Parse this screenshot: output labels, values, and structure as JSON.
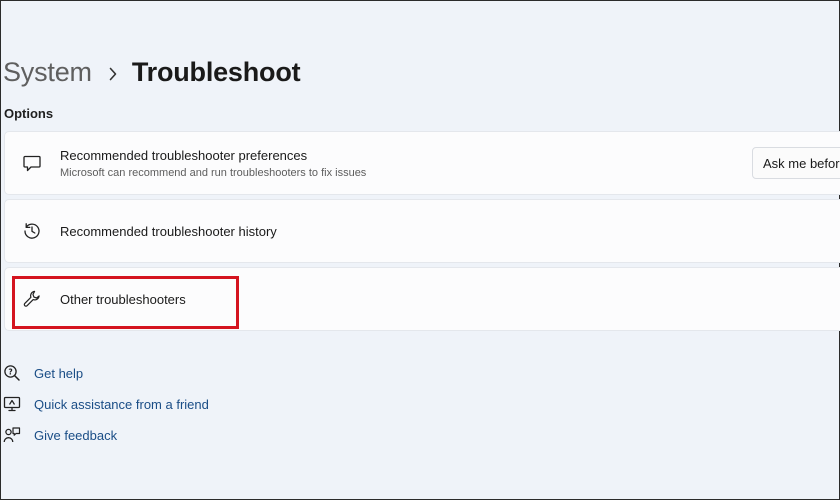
{
  "breadcrumb": {
    "parent": "System",
    "separator": "›",
    "current": "Troubleshoot"
  },
  "options_label": "Options",
  "cards": [
    {
      "title": "Recommended troubleshooter preferences",
      "subtitle": "Microsoft can recommend and run troubleshooters to fix issues",
      "icon": "chat-bubble-icon",
      "dropdown_value": "Ask me before"
    },
    {
      "title": "Recommended troubleshooter history",
      "icon": "history-icon"
    },
    {
      "title": "Other troubleshooters",
      "icon": "wrench-icon"
    }
  ],
  "links": [
    {
      "label": "Get help",
      "icon": "help-search-icon"
    },
    {
      "label": "Quick assistance from a friend",
      "icon": "remote-assist-icon"
    },
    {
      "label": "Give feedback",
      "icon": "feedback-icon"
    }
  ],
  "colors": {
    "background": "#eff3f9",
    "card": "#fcfcfd",
    "link": "#1a4d86",
    "highlight": "#d4141f"
  }
}
